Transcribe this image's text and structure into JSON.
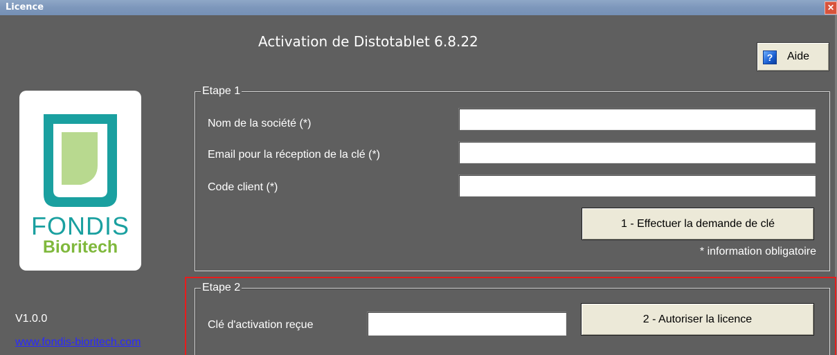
{
  "window": {
    "titlebar_text": "Licence",
    "close_glyph": "✕",
    "title": "Activation de Distotablet 6.8.22"
  },
  "help": {
    "label": "Aide",
    "icon": "help-question-icon",
    "icon_glyph": "?"
  },
  "logo": {
    "line1": "FONDIS",
    "line2": "Bioritech"
  },
  "footer": {
    "version": "V1.0.0",
    "website": "www.fondis-bioritech.com"
  },
  "etape1": {
    "legend": "Etape 1",
    "fields": [
      {
        "label": "Nom de la société (*)",
        "value": ""
      },
      {
        "label": "Email pour la réception de la clé (*)",
        "value": ""
      },
      {
        "label": "Code client (*)",
        "value": ""
      }
    ],
    "request_button": "1 - Effectuer la demande de clé",
    "required_note": "* information obligatoire"
  },
  "etape2": {
    "legend": "Etape 2",
    "key_label": "Clé d'activation reçue",
    "key_value": "",
    "authorize_button": "2 - Autoriser la licence"
  },
  "colors": {
    "background": "#5f5f5f",
    "button_face": "#ece9d8",
    "logo_teal": "#1aa0a0",
    "logo_green": "#7fb83c",
    "highlight": "#e81c1c"
  }
}
